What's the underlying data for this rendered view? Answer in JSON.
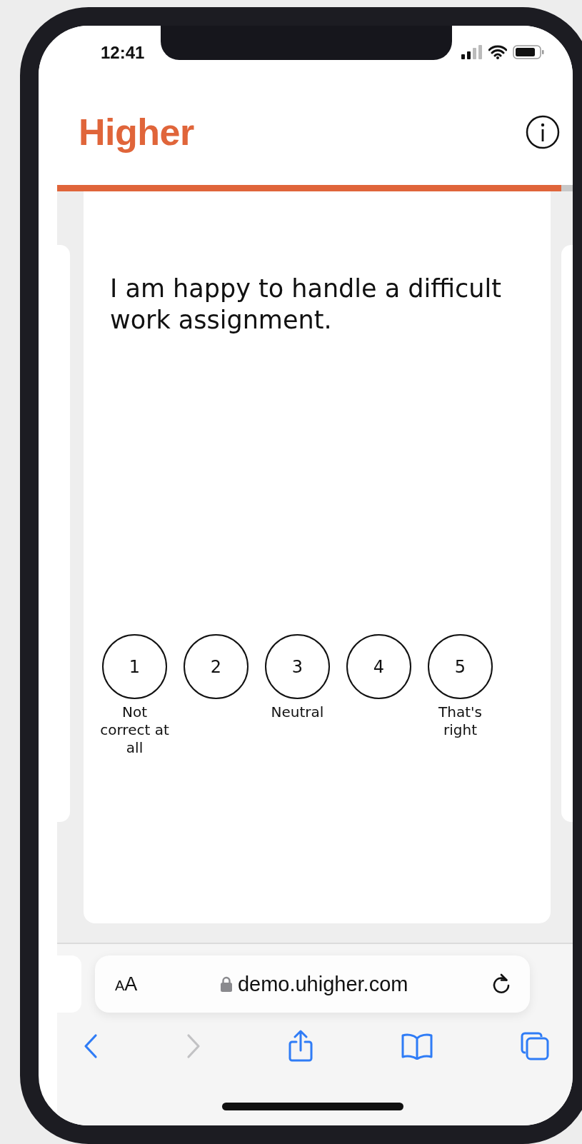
{
  "status_bar": {
    "time": "12:41"
  },
  "header": {
    "logo": "Higher"
  },
  "progress": {
    "level": 0.97
  },
  "question": {
    "text": "I am happy to handle a difficult work assignment."
  },
  "scale": [
    {
      "value": "1",
      "label": "Not correct at all",
      "selected": false
    },
    {
      "value": "2",
      "selected": false
    },
    {
      "value": "3",
      "label": "Neutral",
      "selected": false
    },
    {
      "value": "4",
      "selected": false
    },
    {
      "value": "5",
      "label": "That's right",
      "selected": false
    }
  ],
  "browser": {
    "text_size_button": "AA",
    "url": "demo.uhigher.com"
  },
  "toolbar": [
    {
      "kind": "back",
      "disabled": false
    },
    {
      "kind": "forward",
      "disabled": true
    },
    {
      "kind": "share",
      "disabled": false
    },
    {
      "kind": "bookmarks",
      "disabled": false
    },
    {
      "kind": "tabs",
      "disabled": false
    }
  ]
}
